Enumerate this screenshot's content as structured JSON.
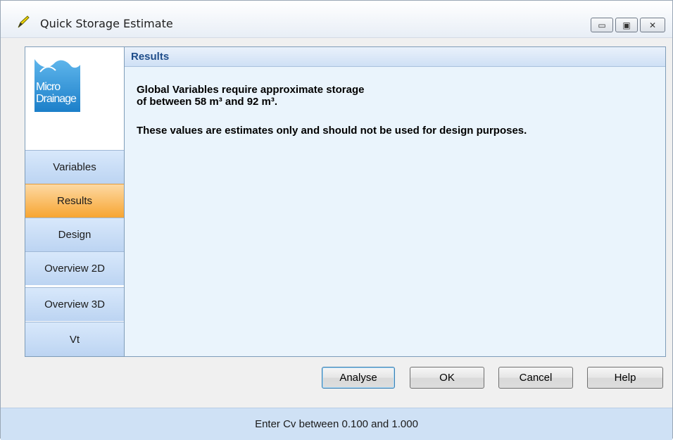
{
  "window": {
    "title": "Quick Storage Estimate",
    "minimize_glyph": "▭",
    "maximize_glyph": "▣",
    "close_glyph": "✕"
  },
  "logo": {
    "line1": "Micro",
    "line2": "Drainage",
    "color": "#1f8fd6"
  },
  "sidebar": {
    "items": [
      {
        "label": "Variables"
      },
      {
        "label": "Results"
      },
      {
        "label": "Design"
      },
      {
        "label": "Overview 2D"
      },
      {
        "label": "Overview 3D"
      },
      {
        "label": "Vt"
      }
    ],
    "active_index": 1
  },
  "panel": {
    "header": "Results",
    "line1": "Global Variables require approximate storage",
    "line2": "of between 58 m³ and 92 m³.",
    "line3": "These values are estimates only and should not be used for design purposes."
  },
  "buttons": {
    "analyse": "Analyse",
    "ok": "OK",
    "cancel": "Cancel",
    "help": "Help"
  },
  "status": {
    "text": "Enter Cv between 0.100 and 1.000"
  }
}
